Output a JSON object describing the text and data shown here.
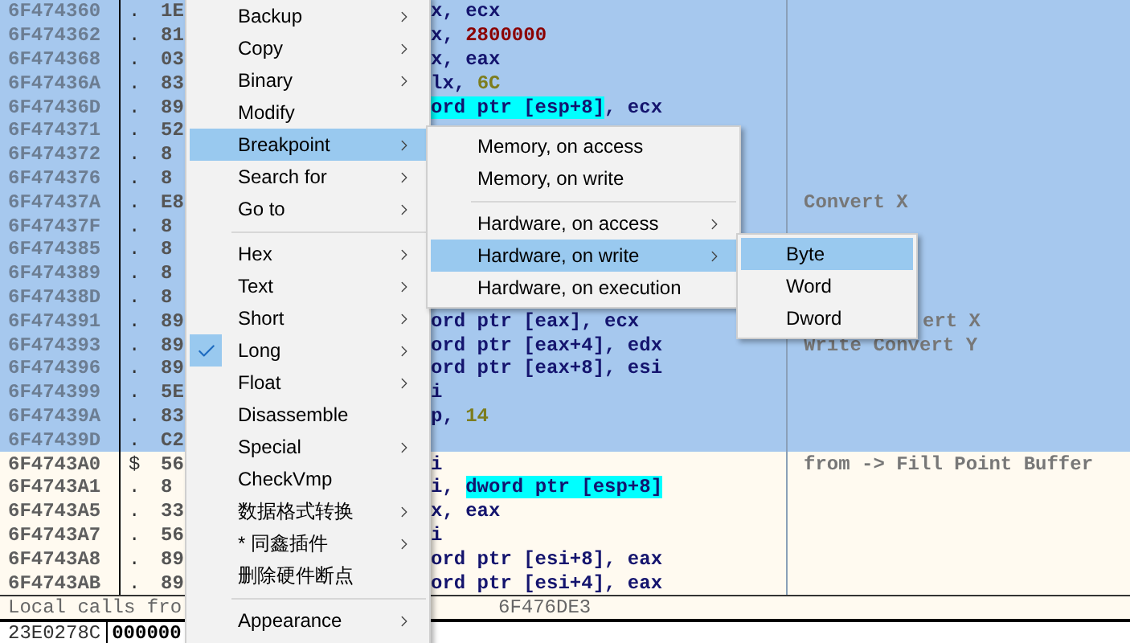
{
  "listing": {
    "rows": [
      {
        "address": "6F474360",
        "marker": ".",
        "bytes": "1E",
        "selected": true,
        "code": [
          {
            "kind": "plain",
            "text": "x, ecx"
          }
        ]
      },
      {
        "address": "6F474362",
        "marker": ".",
        "bytes": "81",
        "selected": true,
        "code": [
          {
            "kind": "plain",
            "text": "x, "
          },
          {
            "kind": "constant",
            "text": "2800000"
          }
        ]
      },
      {
        "address": "6F474368",
        "marker": ".",
        "bytes": "03",
        "selected": true,
        "code": [
          {
            "kind": "plain",
            "text": "x, eax"
          }
        ]
      },
      {
        "address": "6F47436A",
        "marker": ".",
        "bytes": "83",
        "selected": true,
        "code": [
          {
            "kind": "plain",
            "text": "lx, "
          },
          {
            "kind": "number",
            "text": "6C"
          }
        ]
      },
      {
        "address": "6F47436D",
        "marker": ".",
        "bytes": "89",
        "selected": true,
        "code": [
          {
            "kind": "memory",
            "text": "ord ptr [esp+8]"
          },
          {
            "kind": "plain",
            "text": ", ecx"
          }
        ]
      },
      {
        "address": "6F474371",
        "marker": ".",
        "bytes": "52",
        "selected": true
      },
      {
        "address": "6F474372",
        "marker": ".",
        "bytes": "8",
        "selected": true
      },
      {
        "address": "6F474376",
        "marker": ".",
        "bytes": "8",
        "selected": true
      },
      {
        "address": "6F47437A",
        "marker": ".",
        "bytes": "E8",
        "selected": true,
        "comment": "Convert X"
      },
      {
        "address": "6F47437F",
        "marker": ".",
        "bytes": "8",
        "selected": true
      },
      {
        "address": "6F474385",
        "marker": ".",
        "bytes": "8",
        "selected": true
      },
      {
        "address": "6F474389",
        "marker": ".",
        "bytes": "8",
        "selected": true
      },
      {
        "address": "6F47438D",
        "marker": ".",
        "bytes": "8",
        "selected": true
      },
      {
        "address": "6F474391",
        "marker": ".",
        "bytes": "89",
        "selected": true,
        "code": [
          {
            "kind": "plain",
            "text": "ord ptr [eax], ecx"
          }
        ],
        "comment": "ert X",
        "comment_covered": true
      },
      {
        "address": "6F474393",
        "marker": ".",
        "bytes": "89",
        "selected": true,
        "code": [
          {
            "kind": "plain",
            "text": "ord ptr [eax+4], edx"
          }
        ],
        "comment": "Write Convert Y"
      },
      {
        "address": "6F474396",
        "marker": ".",
        "bytes": "89",
        "selected": true,
        "code": [
          {
            "kind": "plain",
            "text": "ord ptr [eax+8], esi"
          }
        ]
      },
      {
        "address": "6F474399",
        "marker": ".",
        "bytes": "5E",
        "selected": true,
        "code": [
          {
            "kind": "plain",
            "text": "i"
          }
        ]
      },
      {
        "address": "6F47439A",
        "marker": ".",
        "bytes": "83",
        "selected": true,
        "code": [
          {
            "kind": "plain",
            "text": "p, "
          },
          {
            "kind": "number",
            "text": "14"
          }
        ]
      },
      {
        "address": "6F47439D",
        "marker": ".",
        "bytes": "C2",
        "selected": true
      },
      {
        "address": "6F4743A0",
        "marker": "$",
        "bytes": "56",
        "selected": false,
        "code": [
          {
            "kind": "plain",
            "text": "i"
          }
        ],
        "comment": "from -> Fill Point Buffer"
      },
      {
        "address": "6F4743A1",
        "marker": ".",
        "bytes": "8",
        "selected": false,
        "code": [
          {
            "kind": "plain",
            "text": "i, "
          },
          {
            "kind": "memory",
            "text": "dword ptr [esp+8]"
          }
        ]
      },
      {
        "address": "6F4743A5",
        "marker": ".",
        "bytes": "33",
        "selected": false,
        "code": [
          {
            "kind": "plain",
            "text": "x, eax"
          }
        ]
      },
      {
        "address": "6F4743A7",
        "marker": ".",
        "bytes": "56",
        "selected": false,
        "code": [
          {
            "kind": "plain",
            "text": "i"
          }
        ]
      },
      {
        "address": "6F4743A8",
        "marker": ".",
        "bytes": "89",
        "selected": false,
        "code": [
          {
            "kind": "plain",
            "text": "ord ptr [esi+8], eax"
          }
        ]
      },
      {
        "address": "6F4743AB",
        "marker": ".",
        "bytes": "89",
        "selected": false,
        "code": [
          {
            "kind": "plain",
            "text": "ord ptr [esi+4], eax"
          }
        ]
      }
    ]
  },
  "call_info": {
    "label": "Local calls fro",
    "target": "6F476DE3"
  },
  "dump": {
    "address": "23E0278C",
    "value": "000000"
  },
  "context_menu": {
    "items": [
      {
        "kind": "item",
        "label": "Backup",
        "submenu": true,
        "selected": false,
        "checked": false
      },
      {
        "kind": "item",
        "label": "Copy",
        "submenu": true,
        "selected": false,
        "checked": false
      },
      {
        "kind": "item",
        "label": "Binary",
        "submenu": true,
        "selected": false,
        "checked": false
      },
      {
        "kind": "item",
        "label": "Modify",
        "submenu": false,
        "selected": false,
        "checked": false
      },
      {
        "kind": "item",
        "label": "Breakpoint",
        "submenu": true,
        "selected": true,
        "checked": false
      },
      {
        "kind": "item",
        "label": "Search for",
        "submenu": true,
        "selected": false,
        "checked": false
      },
      {
        "kind": "item",
        "label": "Go to",
        "submenu": true,
        "selected": false,
        "checked": false
      },
      {
        "kind": "separator"
      },
      {
        "kind": "item",
        "label": "Hex",
        "submenu": true,
        "selected": false,
        "checked": false
      },
      {
        "kind": "item",
        "label": "Text",
        "submenu": true,
        "selected": false,
        "checked": false
      },
      {
        "kind": "item",
        "label": "Short",
        "submenu": true,
        "selected": false,
        "checked": false
      },
      {
        "kind": "item",
        "label": "Long",
        "submenu": true,
        "selected": false,
        "checked": true
      },
      {
        "kind": "item",
        "label": "Float",
        "submenu": true,
        "selected": false,
        "checked": false
      },
      {
        "kind": "item",
        "label": "Disassemble",
        "submenu": false,
        "selected": false,
        "checked": false
      },
      {
        "kind": "item",
        "label": "Special",
        "submenu": true,
        "selected": false,
        "checked": false
      },
      {
        "kind": "item",
        "label": "CheckVmp",
        "submenu": false,
        "selected": false,
        "checked": false
      },
      {
        "kind": "item",
        "label": "数据格式转换",
        "submenu": true,
        "selected": false,
        "checked": false
      },
      {
        "kind": "item",
        "label": "* 同鑫插件",
        "submenu": true,
        "selected": false,
        "checked": false
      },
      {
        "kind": "item",
        "label": "删除硬件断点",
        "submenu": false,
        "selected": false,
        "checked": false
      },
      {
        "kind": "separator"
      },
      {
        "kind": "item",
        "label": "Appearance",
        "submenu": true,
        "selected": false,
        "checked": false
      }
    ]
  },
  "breakpoint_menu": {
    "items": [
      {
        "kind": "item",
        "label": "Memory, on access",
        "submenu": false,
        "selected": false
      },
      {
        "kind": "item",
        "label": "Memory, on write",
        "submenu": false,
        "selected": false
      },
      {
        "kind": "separator"
      },
      {
        "kind": "item",
        "label": "Hardware, on access",
        "submenu": true,
        "selected": false
      },
      {
        "kind": "item",
        "label": "Hardware, on write",
        "submenu": true,
        "selected": true
      },
      {
        "kind": "item",
        "label": "Hardware, on execution",
        "submenu": false,
        "selected": false
      }
    ]
  },
  "size_menu": {
    "items": [
      {
        "kind": "item",
        "label": "Byte",
        "submenu": false,
        "selected": true
      },
      {
        "kind": "item",
        "label": "Word",
        "submenu": false,
        "selected": false
      },
      {
        "kind": "item",
        "label": "Dword",
        "submenu": false,
        "selected": false
      }
    ]
  }
}
